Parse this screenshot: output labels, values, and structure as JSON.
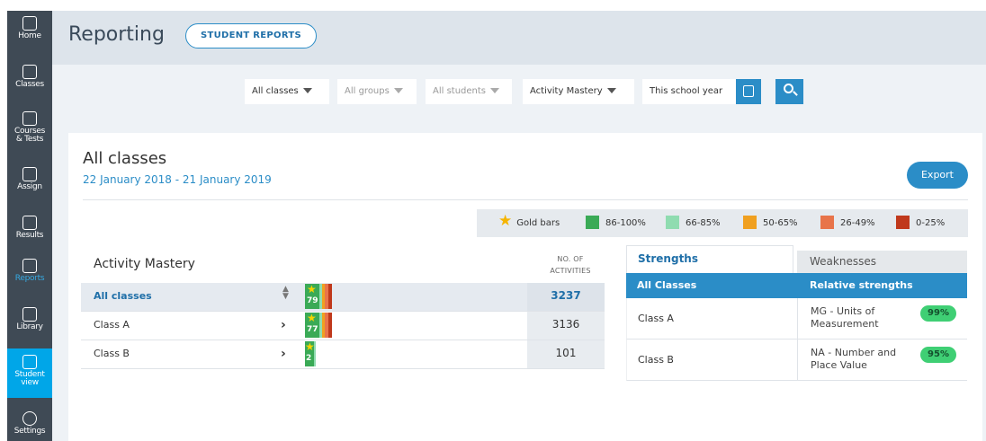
{
  "sidebar": {
    "items": [
      {
        "label": "Home",
        "icon": "home-icon"
      },
      {
        "label": "Classes",
        "icon": "classes-icon"
      },
      {
        "label": "Courses & Tests",
        "icon": "courses-icon"
      },
      {
        "label": "Assign",
        "icon": "assign-icon"
      },
      {
        "label": "Results",
        "icon": "results-icon"
      },
      {
        "label": "Reports",
        "icon": "reports-icon"
      },
      {
        "label": "Library",
        "icon": "library-icon"
      },
      {
        "label": "Student view",
        "icon": "student-view-icon"
      },
      {
        "label": "Settings",
        "icon": "settings-icon"
      }
    ]
  },
  "header": {
    "title": "Reporting",
    "student_reports_label": "STUDENT REPORTS"
  },
  "filters": {
    "classes": "All classes",
    "groups": "All groups",
    "students": "All students",
    "report_type": "Activity Mastery",
    "period": "This school year"
  },
  "card": {
    "title": "All classes",
    "dates": "22 January 2018 - 21 January 2019",
    "export_label": "Export"
  },
  "legend": [
    {
      "label": "Gold bars",
      "color": "#f5b400",
      "kind": "star"
    },
    {
      "label": "86-100%",
      "color": "#3aaa56"
    },
    {
      "label": "66-85%",
      "color": "#8fdcb0"
    },
    {
      "label": "50-65%",
      "color": "#f0a020"
    },
    {
      "label": "26-49%",
      "color": "#e8744a"
    },
    {
      "label": "0-25%",
      "color": "#c0391c"
    }
  ],
  "activity_mastery": {
    "title": "Activity Mastery",
    "count_header_line1": "NO. OF",
    "count_header_line2": "ACTIVITIES",
    "rows": [
      {
        "name": "All classes",
        "gold": "79",
        "count": "3237"
      },
      {
        "name": "Class A",
        "gold": "77",
        "count": "3136"
      },
      {
        "name": "Class B",
        "gold": "2",
        "count": "101"
      }
    ]
  },
  "strengths": {
    "tab_strengths": "Strengths",
    "tab_weaknesses": "Weaknesses",
    "col_classes": "All Classes",
    "col_relative": "Relative strengths",
    "rows": [
      {
        "class": "Class A",
        "topic": "MG - Units of Measurement",
        "pct": "99%"
      },
      {
        "class": "Class B",
        "topic": "NA - Number and Place Value",
        "pct": "95%"
      }
    ]
  }
}
